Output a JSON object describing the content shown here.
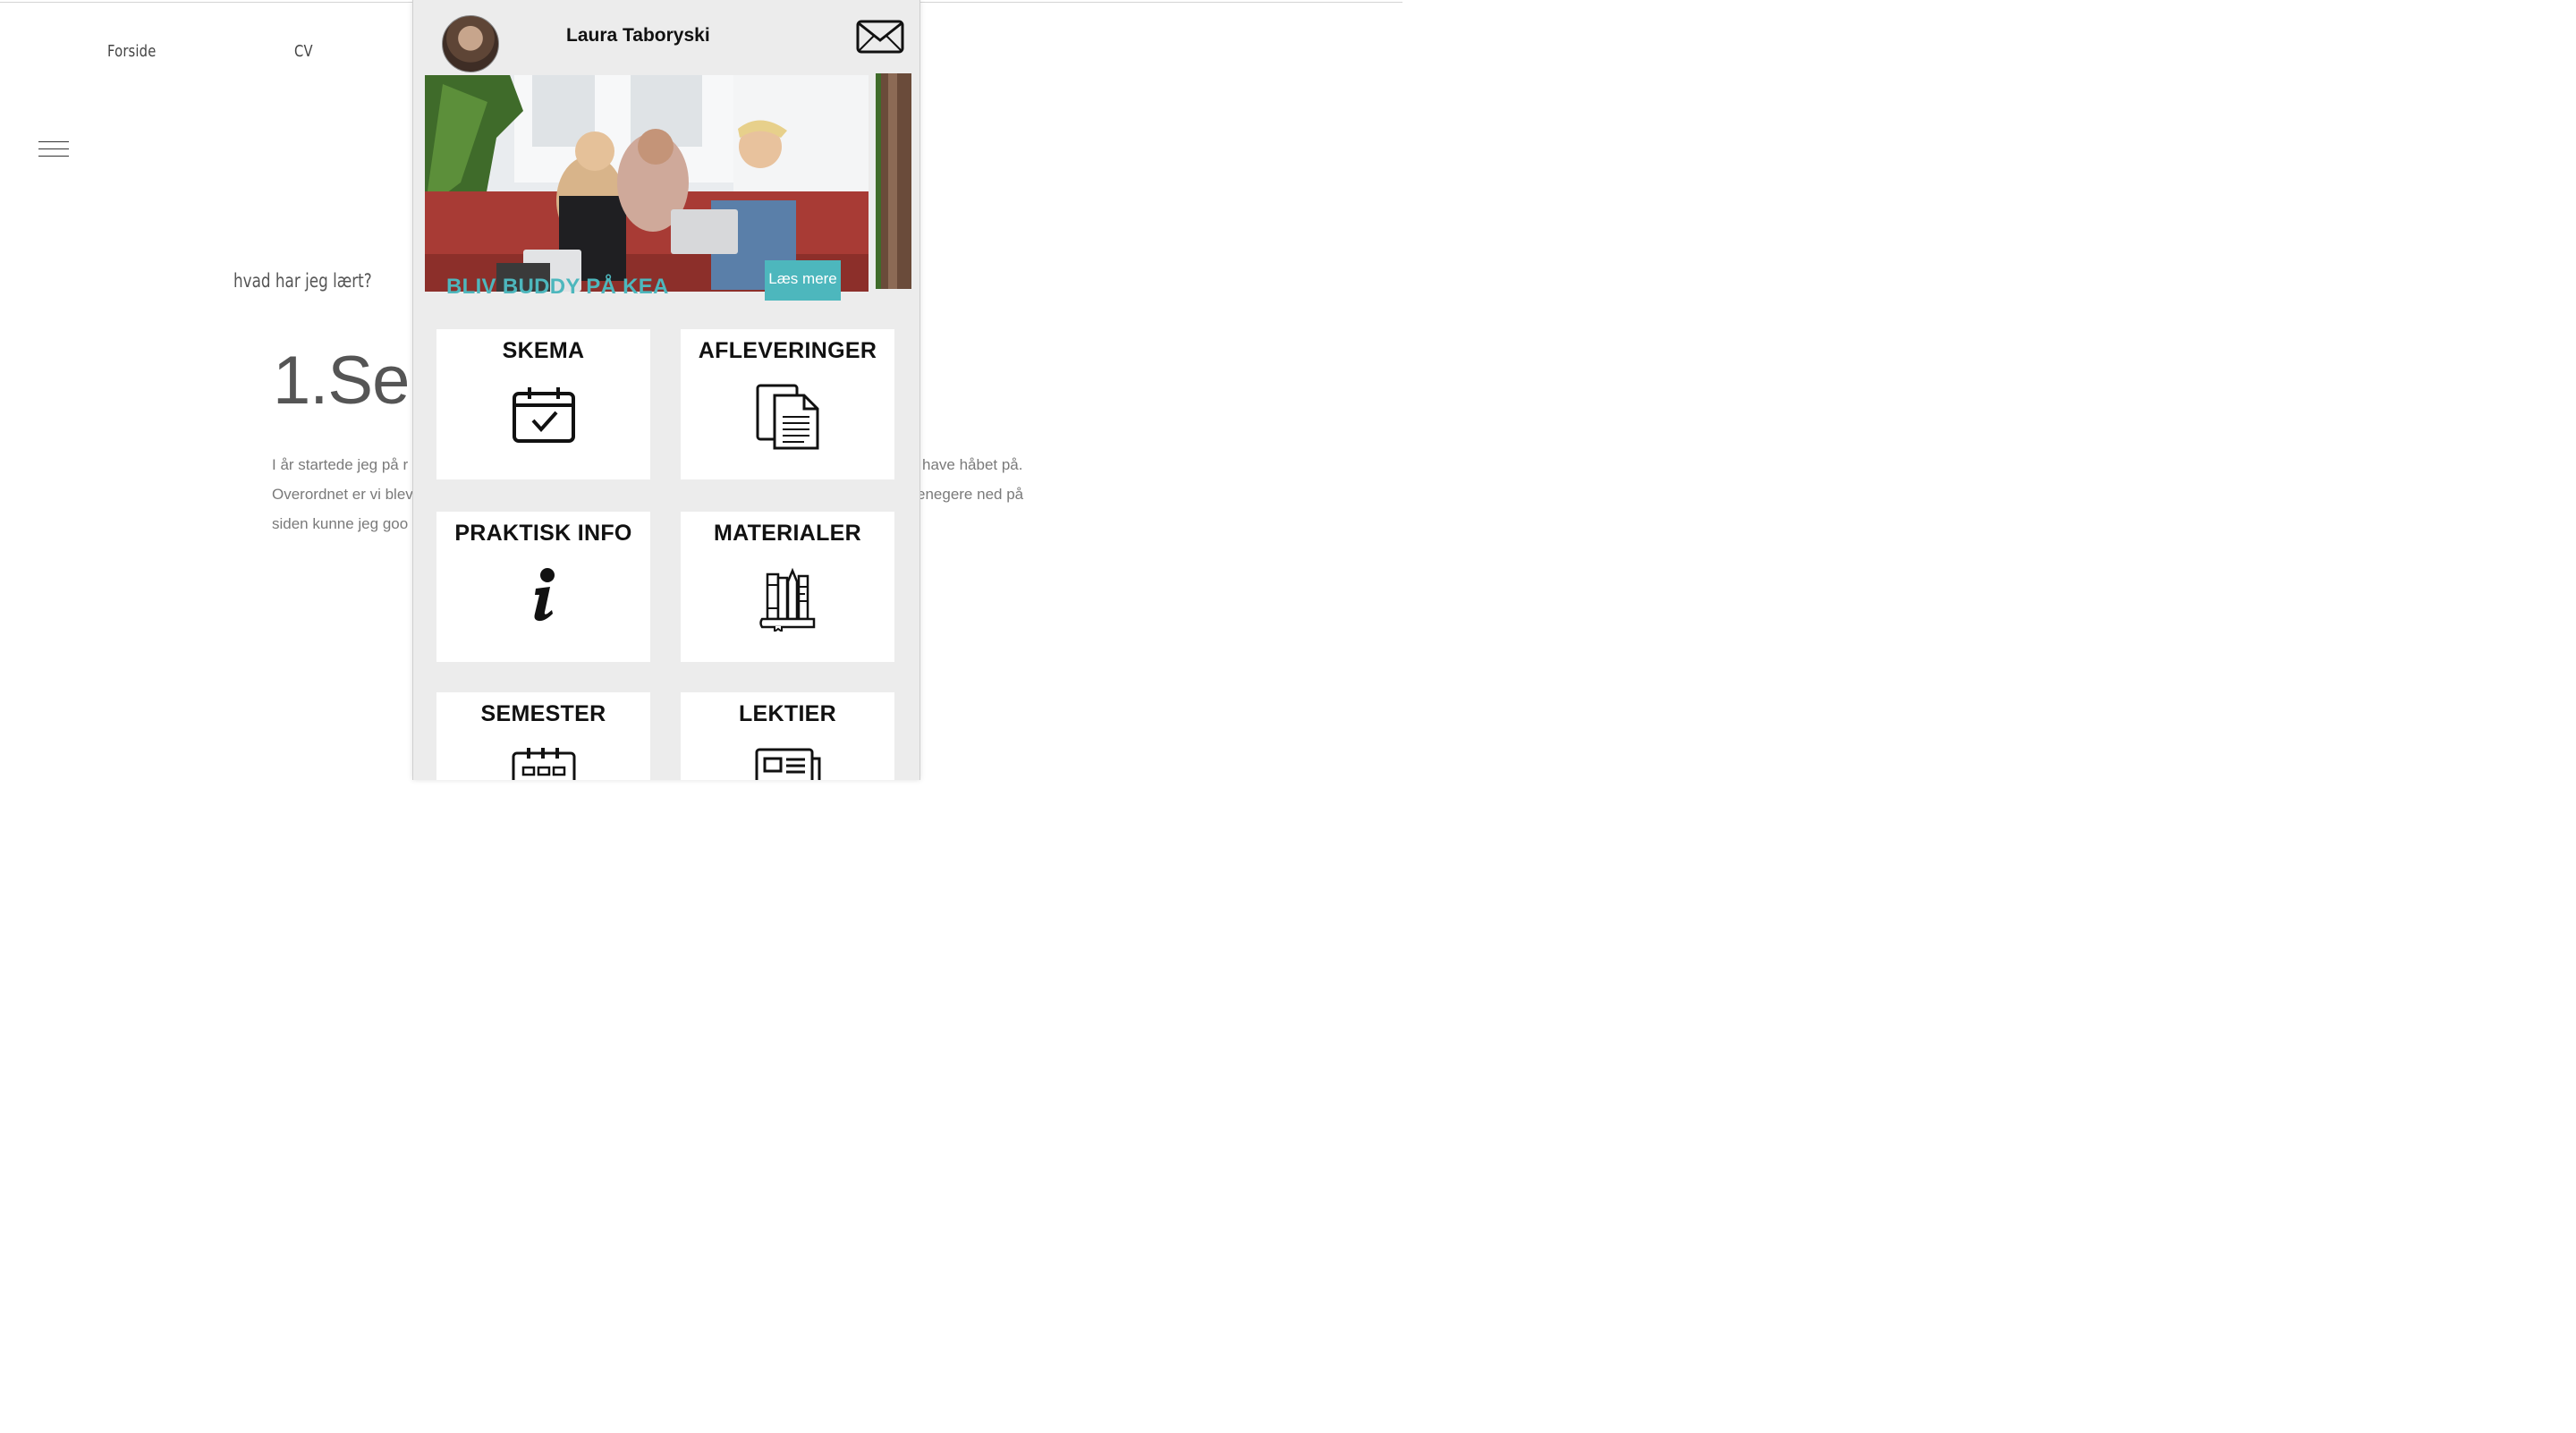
{
  "site_nav": {
    "home": "Forside",
    "cv": "CV"
  },
  "page": {
    "subheading": "hvad har jeg lært?",
    "title": "1.Se",
    "para_left": [
      "I år startede jeg på r",
      "Overordnet er vi blev",
      "siden kunne jeg goo"
    ],
    "para_right": [
      "have håbet på.",
      "enegere ned på"
    ]
  },
  "overlay": {
    "user_name": "Laura Taboryski",
    "banner": {
      "title": "BLIV BUDDY PÅ KEA",
      "button": "Læs mere"
    },
    "tiles": [
      {
        "label": "SKEMA",
        "icon": "calendar-check-icon"
      },
      {
        "label": "AFLEVERINGER",
        "icon": "documents-icon"
      },
      {
        "label": "PRAKTISK INFO",
        "icon": "info-icon"
      },
      {
        "label": "MATERIALER",
        "icon": "books-icon"
      },
      {
        "label": "SEMESTER",
        "icon": "planner-icon"
      },
      {
        "label": "LEKTIER",
        "icon": "newspaper-icon"
      }
    ],
    "accent_color": "#4db7bd"
  }
}
